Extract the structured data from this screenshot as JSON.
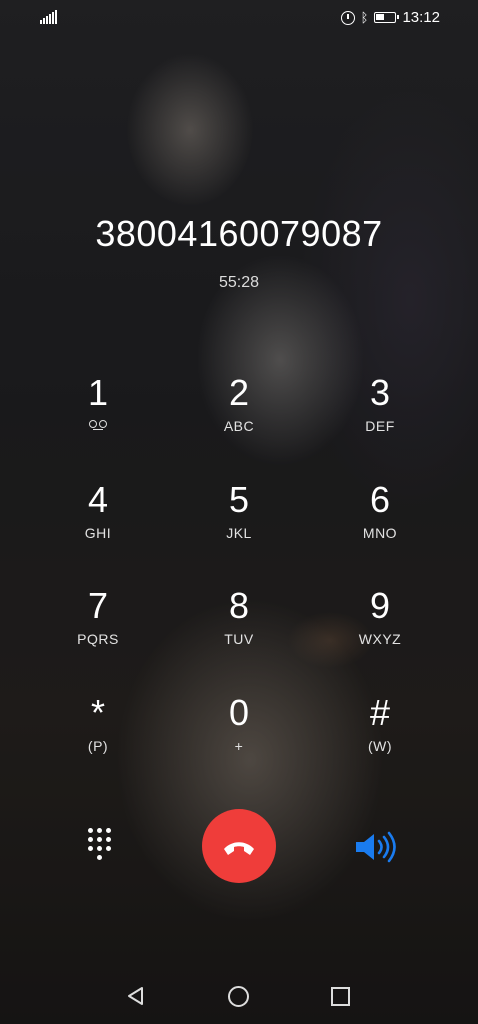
{
  "status_bar": {
    "time": "13:12",
    "icons": [
      "signal-icon",
      "alarm-icon",
      "bluetooth-icon",
      "battery-icon"
    ]
  },
  "call": {
    "number": "38004160079087",
    "duration": "55:28"
  },
  "keypad": {
    "keys": [
      {
        "digit": "1",
        "letters": ""
      },
      {
        "digit": "2",
        "letters": "ABC"
      },
      {
        "digit": "3",
        "letters": "DEF"
      },
      {
        "digit": "4",
        "letters": "GHI"
      },
      {
        "digit": "5",
        "letters": "JKL"
      },
      {
        "digit": "6",
        "letters": "MNO"
      },
      {
        "digit": "7",
        "letters": "PQRS"
      },
      {
        "digit": "8",
        "letters": "TUV"
      },
      {
        "digit": "9",
        "letters": "WXYZ"
      },
      {
        "digit": "*",
        "letters": "(P)"
      },
      {
        "digit": "0",
        "letters": "+"
      },
      {
        "digit": "#",
        "letters": "(W)"
      }
    ]
  },
  "controls": {
    "icons": [
      "dialpad-icon",
      "end-call-icon",
      "speaker-icon"
    ],
    "end_call_color": "#ef3d3a",
    "speaker_active_color": "#1a7cf0"
  },
  "nav": {
    "icons": [
      "back-icon",
      "home-icon",
      "recent-apps-icon"
    ]
  }
}
